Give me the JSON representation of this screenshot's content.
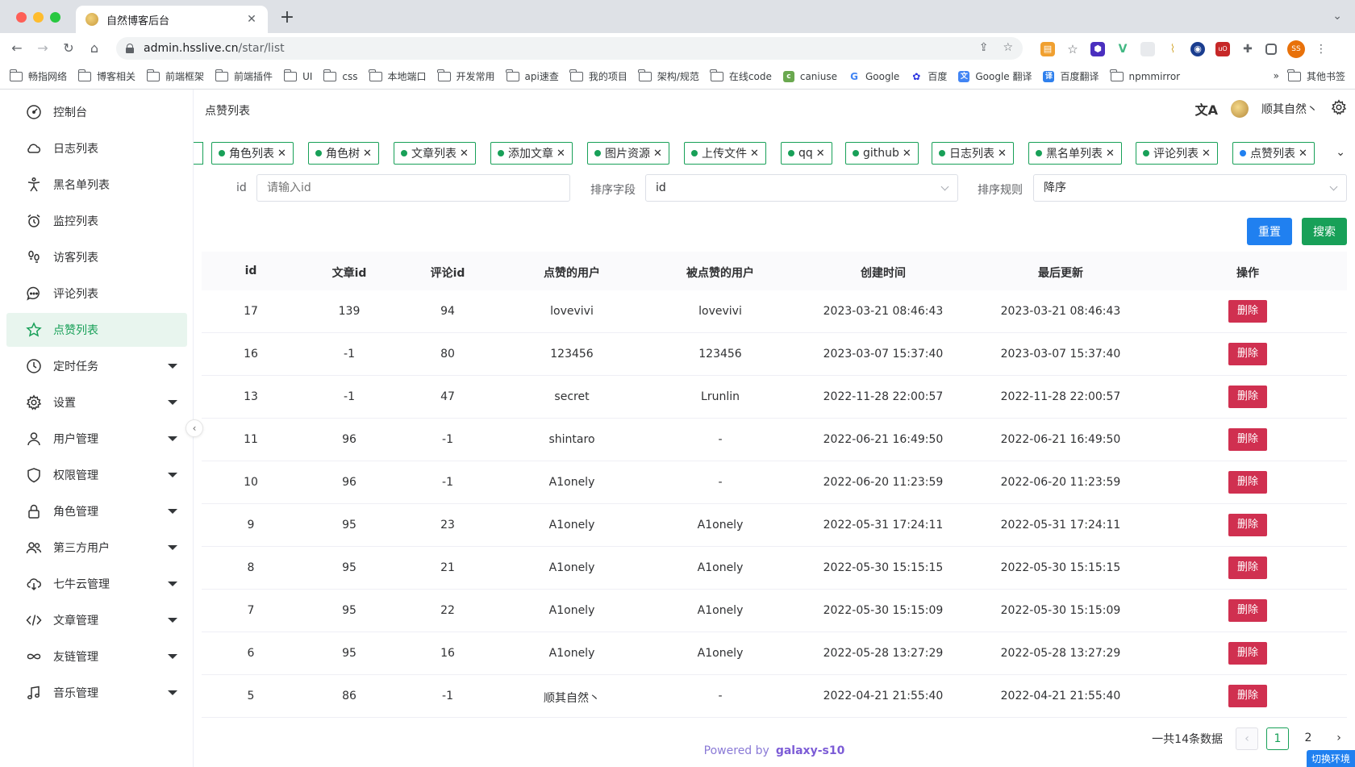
{
  "browser": {
    "tab_title": "自然博客后台",
    "url_host": "admin.hsslive.cn",
    "url_path": "/star/list",
    "profile_initials": "SS",
    "bookmarks": [
      "畅指网络",
      "博客相关",
      "前端框架",
      "前端插件",
      "UI",
      "css",
      "本地端口",
      "开发常用",
      "api速查",
      "我的项目",
      "架构/规范",
      "在线code",
      "caniuse",
      "Google",
      "百度",
      "Google 翻译",
      "百度翻译",
      "npmmirror"
    ],
    "more_bookmarks": "»",
    "other_bookmarks": "其他书签"
  },
  "sidebar": {
    "items": [
      {
        "label": "控制台",
        "icon": "dashboard-icon"
      },
      {
        "label": "日志列表",
        "icon": "cloud-icon"
      },
      {
        "label": "黑名单列表",
        "icon": "person-pose-icon"
      },
      {
        "label": "监控列表",
        "icon": "alarm-clock-icon"
      },
      {
        "label": "访客列表",
        "icon": "footprints-icon"
      },
      {
        "label": "评论列表",
        "icon": "chat-bubble-icon"
      },
      {
        "label": "点赞列表",
        "icon": "star-icon",
        "active": true
      },
      {
        "label": "定时任务",
        "icon": "clock-icon",
        "has_children": true
      },
      {
        "label": "设置",
        "icon": "gear-icon",
        "has_children": true
      },
      {
        "label": "用户管理",
        "icon": "user-icon",
        "has_children": true
      },
      {
        "label": "权限管理",
        "icon": "shield-icon",
        "has_children": true
      },
      {
        "label": "角色管理",
        "icon": "lock-icon",
        "has_children": true
      },
      {
        "label": "第三方用户",
        "icon": "people-icon",
        "has_children": true
      },
      {
        "label": "七牛云管理",
        "icon": "cloud-download-icon",
        "has_children": true
      },
      {
        "label": "文章管理",
        "icon": "code-icon",
        "has_children": true
      },
      {
        "label": "友链管理",
        "icon": "infinity-icon",
        "has_children": true
      },
      {
        "label": "音乐管理",
        "icon": "music-note-icon",
        "has_children": true
      }
    ]
  },
  "header": {
    "breadcrumb": "点赞列表",
    "user_name": "顺其自然丶"
  },
  "tags": [
    {
      "label": "角色列表"
    },
    {
      "label": "角色树"
    },
    {
      "label": "文章列表"
    },
    {
      "label": "添加文章"
    },
    {
      "label": "图片资源"
    },
    {
      "label": "上传文件"
    },
    {
      "label": "qq"
    },
    {
      "label": "github"
    },
    {
      "label": "日志列表"
    },
    {
      "label": "黑名单列表"
    },
    {
      "label": "评论列表"
    },
    {
      "label": "点赞列表",
      "active": true
    }
  ],
  "filter": {
    "id_label": "id",
    "id_placeholder": "请输入id",
    "sort_field_label": "排序字段",
    "sort_field_value": "id",
    "sort_rule_label": "排序规则",
    "sort_rule_value": "降序",
    "reset_label": "重置",
    "search_label": "搜索"
  },
  "table": {
    "columns": [
      "id",
      "文章id",
      "评论id",
      "点赞的用户",
      "被点赞的用户",
      "创建时间",
      "最后更新",
      "操作"
    ],
    "delete_label": "删除",
    "rows": [
      {
        "id": "17",
        "article_id": "139",
        "comment_id": "94",
        "from_user": "lovevivi",
        "to_user": "lovevivi",
        "created_at": "2023-03-21 08:46:43",
        "updated_at": "2023-03-21 08:46:43"
      },
      {
        "id": "16",
        "article_id": "-1",
        "comment_id": "80",
        "from_user": "123456",
        "to_user": "123456",
        "created_at": "2023-03-07 15:37:40",
        "updated_at": "2023-03-07 15:37:40"
      },
      {
        "id": "13",
        "article_id": "-1",
        "comment_id": "47",
        "from_user": "secret",
        "to_user": "Lrunlin",
        "created_at": "2022-11-28 22:00:57",
        "updated_at": "2022-11-28 22:00:57"
      },
      {
        "id": "11",
        "article_id": "96",
        "comment_id": "-1",
        "from_user": "shintaro",
        "to_user": "-",
        "created_at": "2022-06-21 16:49:50",
        "updated_at": "2022-06-21 16:49:50"
      },
      {
        "id": "10",
        "article_id": "96",
        "comment_id": "-1",
        "from_user": "A1onely",
        "to_user": "-",
        "created_at": "2022-06-20 11:23:59",
        "updated_at": "2022-06-20 11:23:59"
      },
      {
        "id": "9",
        "article_id": "95",
        "comment_id": "23",
        "from_user": "A1onely",
        "to_user": "A1onely",
        "created_at": "2022-05-31 17:24:11",
        "updated_at": "2022-05-31 17:24:11"
      },
      {
        "id": "8",
        "article_id": "95",
        "comment_id": "21",
        "from_user": "A1onely",
        "to_user": "A1onely",
        "created_at": "2022-05-30 15:15:15",
        "updated_at": "2022-05-30 15:15:15"
      },
      {
        "id": "7",
        "article_id": "95",
        "comment_id": "22",
        "from_user": "A1onely",
        "to_user": "A1onely",
        "created_at": "2022-05-30 15:15:09",
        "updated_at": "2022-05-30 15:15:09"
      },
      {
        "id": "6",
        "article_id": "95",
        "comment_id": "16",
        "from_user": "A1onely",
        "to_user": "A1onely",
        "created_at": "2022-05-28 13:27:29",
        "updated_at": "2022-05-28 13:27:29"
      },
      {
        "id": "5",
        "article_id": "86",
        "comment_id": "-1",
        "from_user": "顺其自然丶",
        "to_user": "-",
        "created_at": "2022-04-21 21:55:40",
        "updated_at": "2022-04-21 21:55:40"
      }
    ]
  },
  "pagination": {
    "total_text": "一共14条数据",
    "pages": [
      "1",
      "2"
    ],
    "current": "1"
  },
  "footer": {
    "powered": "Powered by",
    "brand": "galaxy-s10"
  },
  "env_badge": "切换环境",
  "colors": {
    "primary_green": "#18a058",
    "primary_blue": "#2080f0",
    "danger_red": "#d03050"
  }
}
